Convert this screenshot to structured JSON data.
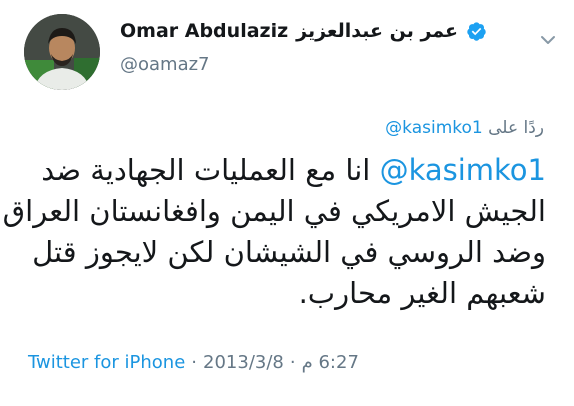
{
  "user": {
    "name_en": "Omar Abdulaziz",
    "name_ar": "عمر بن عبدالعزيز",
    "handle": "@oamaz7"
  },
  "reply": {
    "prefix": "ردًا على",
    "to": "@kasimko1"
  },
  "tweet": {
    "mention": "@kasimko1",
    "line1": "انا مع العمليات الجهادية ضد",
    "line2": "الجيش الامريكي في اليمن وافغانستان العراق",
    "line3": "وضد الروسي في الشيشان لكن لايجوز قتل",
    "line4": "شعبهم الغير محارب."
  },
  "meta": {
    "source": "Twitter for iPhone",
    "sep1": "·",
    "date": "2013/3/8",
    "sep2": "·",
    "time": "6:27 م"
  },
  "colors": {
    "link": "#1b95e0",
    "secondary": "#657786",
    "verified": "#1da1f2"
  },
  "icons": [
    "verified-badge-icon",
    "chevron-down-icon"
  ]
}
